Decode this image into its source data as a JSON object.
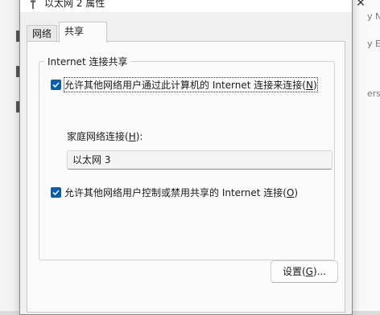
{
  "dialog": {
    "title": "以太网 2 属性",
    "tabs": [
      {
        "label": "网络"
      },
      {
        "label": "共享"
      }
    ],
    "active_tab": "共享"
  },
  "sharing": {
    "group_title": "Internet 连接共享",
    "allow_sharing": {
      "text_before_key": "允许其他网络用户通过此计算机的 Internet 连接来连接(",
      "access_key": "N",
      "text_after_key": ")",
      "checked": true
    },
    "home_network": {
      "label_before_key": "家庭网络连接(",
      "access_key": "H",
      "label_after_key": "):",
      "selected_value": "以太网 3"
    },
    "allow_control": {
      "text_before_key": "允许其他网络用户控制或禁用共享的 Internet 连接(",
      "access_key": "O",
      "text_after_key": ")",
      "checked": true
    },
    "settings_button": {
      "text_before_key": "设置(",
      "access_key": "G",
      "text_after_key": ")..."
    }
  },
  "background": {
    "right_fragments": [
      "y Net",
      "y Ethe",
      "erson"
    ],
    "close_glyph": "✕"
  },
  "colors": {
    "accent": "#005fb8",
    "dialog_bg": "#f0f0f0",
    "panel_bg": "#fbfbfb"
  }
}
